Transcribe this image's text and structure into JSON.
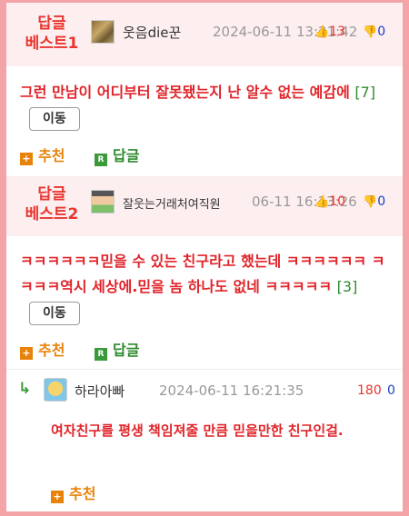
{
  "comments": [
    {
      "badge_line1": "답글",
      "badge_line2": "베스트1",
      "author": "웃음die꾼",
      "date": "2024-06-11 13:21:42",
      "up": "13",
      "down": "0",
      "body": "그런 만남이 어디부터 잘못됐는지 난 알수 없는 예감에",
      "reply_count": "[7]",
      "move_label": "이동",
      "recommend_label": "추천",
      "reply_label": "답글"
    },
    {
      "badge_line1": "답글",
      "badge_line2": "베스트2",
      "author": "잘웃는거래처여직원",
      "date": "06-11 16:13:26",
      "up": "10",
      "down": "0",
      "body": "ㅋㅋㅋㅋㅋㅋ믿을 수 있는 친구라고 했는데 ㅋㅋㅋㅋㅋㅋ ㅋㅋㅋㅋ역시 세상에.믿을 놈 하나도 없네 ㅋㅋㅋㅋㅋ",
      "reply_count": "[3]",
      "move_label": "이동",
      "recommend_label": "추천",
      "reply_label": "답글"
    }
  ],
  "reply": {
    "arrow": "↳",
    "author": "하라아빠",
    "date": "2024-06-11 16:21:35",
    "up": "180",
    "down": "0",
    "body": "여자친구를 평생 책임져줄 만큼 믿을만한 친구인걸.",
    "recommend_label": "추천"
  },
  "colors": {
    "accent_red": "#e8362f",
    "frame_pink": "#f4a3a6",
    "header_bg": "#fdeef0",
    "count_green": "#2e8b2e",
    "down_blue": "#1a3fc4"
  }
}
